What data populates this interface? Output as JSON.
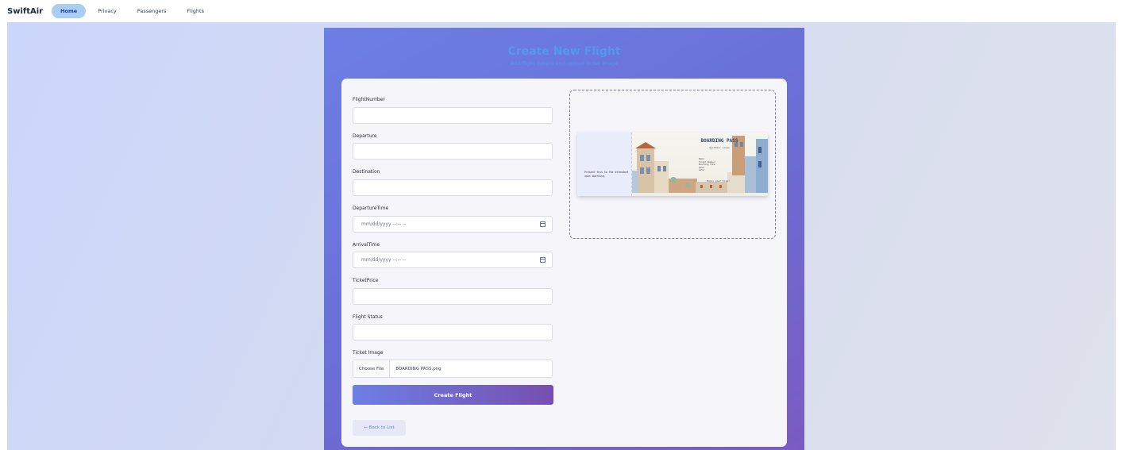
{
  "nav": {
    "brand": "SwiftAir",
    "links": [
      "Home",
      "Privacy",
      "Passengers",
      "Flights"
    ]
  },
  "header": {
    "title": "Create New Flight",
    "subtitle": "Add flight details and upload ticket image"
  },
  "form": {
    "fields": [
      {
        "label": "FlightNumber",
        "value": ""
      },
      {
        "label": "Departure",
        "value": ""
      },
      {
        "label": "Destination",
        "value": ""
      },
      {
        "label": "DepartureTime",
        "placeholder": "mm/dd/yyyy --:-- --"
      },
      {
        "label": "ArrivalTime",
        "placeholder": "mm/dd/yyyy --:-- --"
      },
      {
        "label": "TicketPrice",
        "value": ""
      },
      {
        "label": "Flight Status",
        "value": ""
      },
      {
        "label": "Ticket Image"
      }
    ],
    "file_button": "Choose File",
    "file_name": "BOARDING PASS.png",
    "submit": "Create Flight",
    "back": "← Back to List"
  },
  "preview": {
    "pass_title": "BOARDING PASS",
    "pass_subtitle": "SwiftAir Lines",
    "stub_text": "Present this to the attendant upon boarding.",
    "details": [
      "Name:",
      "Flight Number:",
      "Boarding Time:",
      "Seat:",
      "Gate:"
    ],
    "footer": "Enjoy your trip!"
  },
  "colors": {
    "accent": "#6c7fe6",
    "active_nav": "#a9cdf3",
    "title_blue": "#3ab6ff"
  }
}
